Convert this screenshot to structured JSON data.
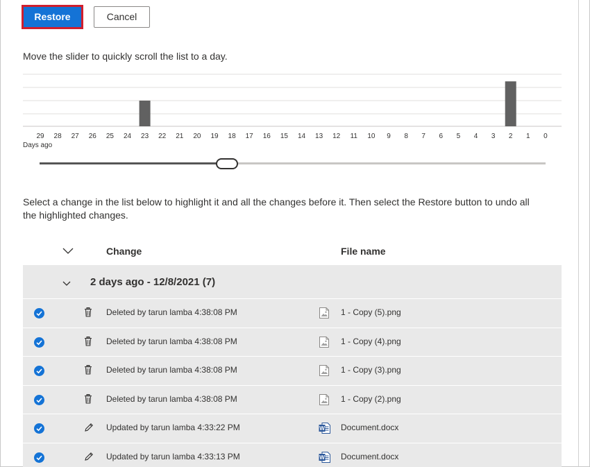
{
  "toolbar": {
    "restore_label": "Restore",
    "cancel_label": "Cancel"
  },
  "slider": {
    "instruction": "Move the slider to quickly scroll the list to a day.",
    "days_ago_label": "Days ago",
    "day_ticks": [
      "29",
      "28",
      "27",
      "26",
      "25",
      "24",
      "23",
      "22",
      "21",
      "20",
      "19",
      "18",
      "17",
      "16",
      "15",
      "14",
      "13",
      "12",
      "11",
      "10",
      "9",
      "8",
      "7",
      "6",
      "5",
      "4",
      "3",
      "2",
      "1",
      "0"
    ],
    "activity_counts": [
      0,
      0,
      0,
      0,
      0,
      0,
      2,
      0,
      0,
      0,
      0,
      0,
      0,
      0,
      0,
      0,
      0,
      0,
      0,
      0,
      0,
      0,
      0,
      0,
      0,
      0,
      0,
      3.5,
      0,
      0
    ],
    "position_fraction": 0.37,
    "bar_color": "#616161"
  },
  "list": {
    "instruction": "Select a change in the list below to highlight it and all the changes before it. Then select the Restore button to undo all the highlighted changes.",
    "header_change": "Change",
    "header_file": "File name",
    "group_title": "2 days ago - 12/8/2021 (7)",
    "rows": [
      {
        "change": "Deleted by tarun lamba 4:38:08 PM",
        "file": "1 - Copy (5).png",
        "action_icon": "trash-icon",
        "file_icon": "image-file-icon"
      },
      {
        "change": "Deleted by tarun lamba 4:38:08 PM",
        "file": "1 - Copy (4).png",
        "action_icon": "trash-icon",
        "file_icon": "image-file-icon"
      },
      {
        "change": "Deleted by tarun lamba 4:38:08 PM",
        "file": "1 - Copy (3).png",
        "action_icon": "trash-icon",
        "file_icon": "image-file-icon"
      },
      {
        "change": "Deleted by tarun lamba 4:38:08 PM",
        "file": "1 - Copy (2).png",
        "action_icon": "trash-icon",
        "file_icon": "image-file-icon"
      },
      {
        "change": "Updated by tarun lamba 4:33:22 PM",
        "file": "Document.docx",
        "action_icon": "pencil-icon",
        "file_icon": "word-file-icon"
      },
      {
        "change": "Updated by tarun lamba 4:33:13 PM",
        "file": "Document.docx",
        "action_icon": "pencil-icon",
        "file_icon": "word-file-icon"
      }
    ]
  },
  "colors": {
    "accent": "#1473d6",
    "highlight_border": "#d11f2d",
    "row_bg": "#e9e9e9"
  }
}
